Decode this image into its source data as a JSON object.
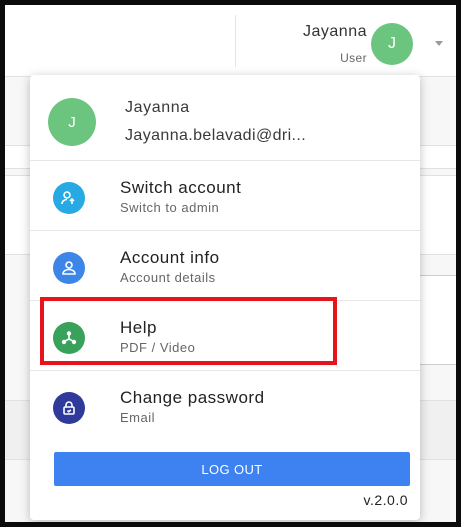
{
  "header": {
    "user_name": "Jayanna",
    "user_role": "User",
    "avatar_initial": "J"
  },
  "profile": {
    "avatar_initial": "J",
    "name": "Jayanna",
    "email": "Jayanna.belavadi@dri..."
  },
  "menu": {
    "items": [
      {
        "title": "Switch account",
        "subtitle": "Switch to admin",
        "icon": "switch-user-icon",
        "color": "#27a9e3"
      },
      {
        "title": "Account info",
        "subtitle": "Account details",
        "icon": "user-icon",
        "color": "#3d86e8"
      },
      {
        "title": "Help",
        "subtitle": "PDF / Video",
        "icon": "share-nodes-icon",
        "color": "#38a15a"
      },
      {
        "title": "Change password",
        "subtitle": "Email",
        "icon": "lock-icon",
        "color": "#2f3a9b"
      }
    ]
  },
  "logout_label": "LOG OUT",
  "version": "v.2.0.0",
  "colors": {
    "avatar": "#6cc57f",
    "logout": "#3d82f0",
    "highlight": "#e8141c"
  }
}
